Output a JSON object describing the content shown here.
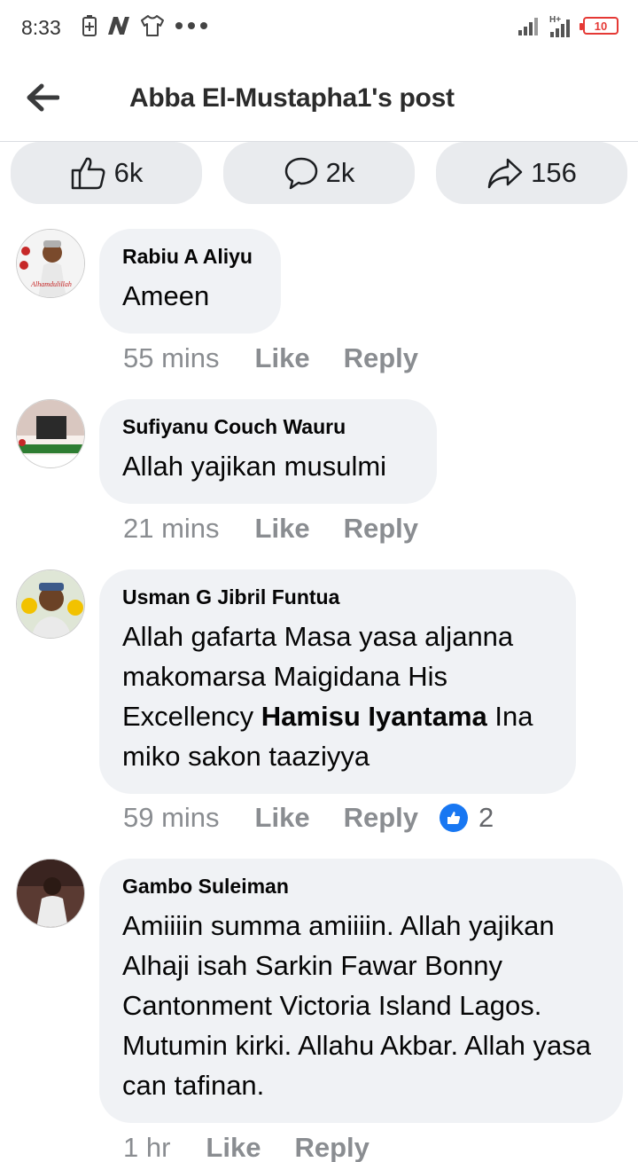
{
  "status_bar": {
    "time": "8:33",
    "battery": "10",
    "icons": [
      "battery-saver-icon",
      "n-app-icon",
      "shirt-app-icon",
      "more-dots-icon",
      "signal-icon",
      "signal-hplus-icon",
      "battery-icon"
    ]
  },
  "header": {
    "title": "Abba El-Mustapha1's post",
    "back_icon": "back-arrow-icon"
  },
  "actions": {
    "likes": "6k",
    "comments": "2k",
    "shares": "156"
  },
  "comments": [
    {
      "author": "Rabiu A Aliyu",
      "text": "Ameen",
      "time": "55 mins",
      "like_label": "Like",
      "reply_label": "Reply",
      "avatar_text": "Alhamdulillah"
    },
    {
      "author": "Sufiyanu Couch Wauru",
      "text": "Allah yajikan musulmi",
      "time": "21 mins",
      "like_label": "Like",
      "reply_label": "Reply"
    },
    {
      "author": "Usman G Jibril Funtua",
      "text_before": "Allah gafarta Masa yasa aljanna makomarsa Maigidana His Excellency ",
      "mention": "Hamisu Iyantama",
      "text_after": " Ina miko sakon taaziyya",
      "time": "59 mins",
      "like_label": "Like",
      "reply_label": "Reply",
      "reaction_count": "2"
    },
    {
      "author": "Gambo Suleiman",
      "text": "Amiiiin summa amiiiin. Allah yajikan Alhaji isah Sarkin Fawar Bonny Cantonment Victoria Island Lagos. Mutumin kirki. Allahu Akbar. Allah yasa can tafinan.",
      "time": "1 hr",
      "like_label": "Like",
      "reply_label": "Reply"
    }
  ],
  "colors": {
    "bubble": "#f0f2f5",
    "button": "#e9ebee",
    "meta": "#8a8d91",
    "accent": "#1877f2",
    "battery": "#e53935"
  }
}
